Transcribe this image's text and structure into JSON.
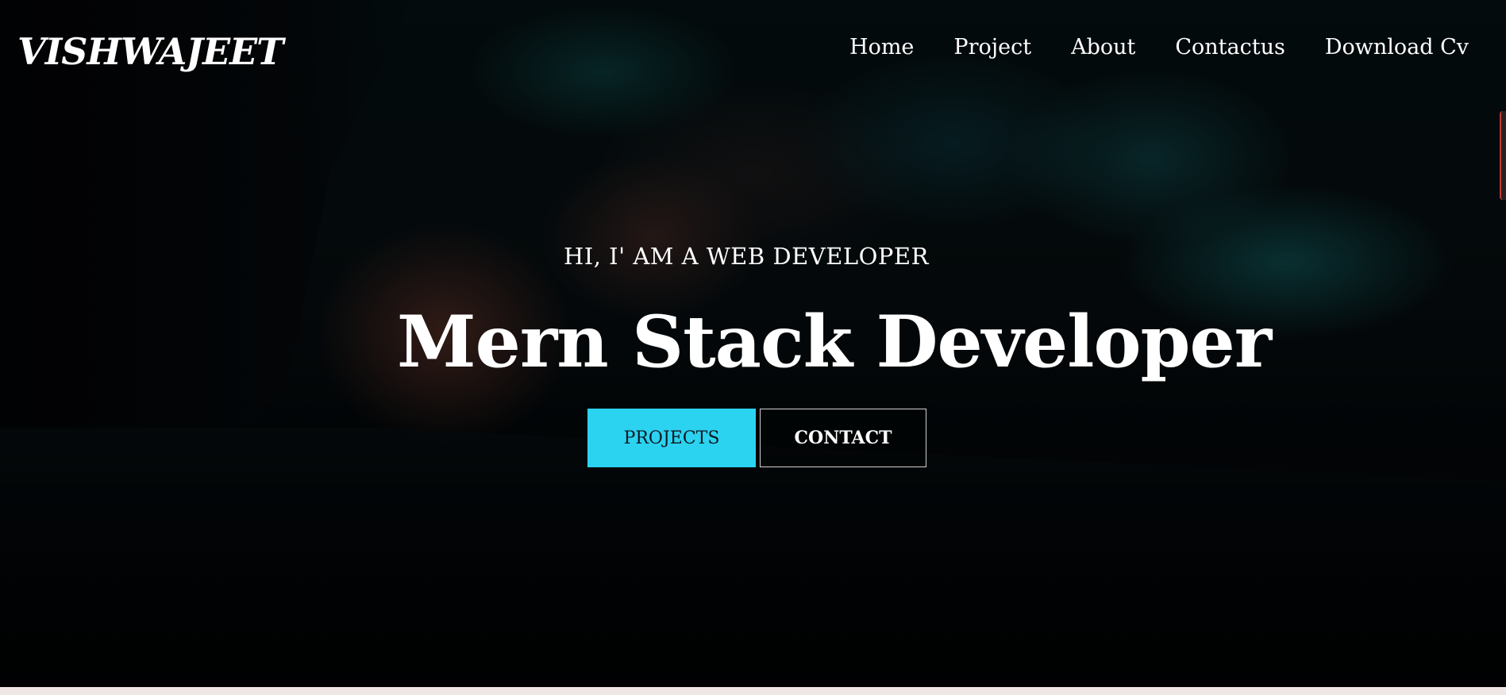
{
  "brand": {
    "logo_text": "VISHWAJEET"
  },
  "nav": {
    "items": [
      {
        "label": "Home"
      },
      {
        "label": "Project"
      },
      {
        "label": "About"
      },
      {
        "label": "Contactus"
      },
      {
        "label": "Download Cv"
      }
    ]
  },
  "hero": {
    "subtitle": "HI, I' AM A WEB DEVELOPER",
    "headline": "Mern Stack Developer",
    "buttons": {
      "projects_label": "PROJECTS",
      "contact_label": "CONTACT"
    }
  },
  "colors": {
    "accent": "#2bd3f0",
    "text": "#ffffff",
    "background": "#050b0e"
  }
}
